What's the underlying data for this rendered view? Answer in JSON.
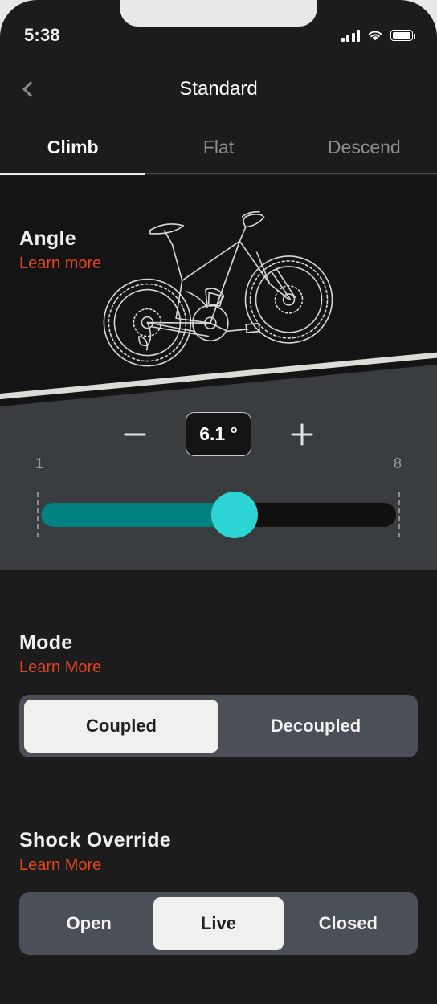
{
  "status_bar": {
    "time": "5:38",
    "signal_icon": "cellular-signal-icon",
    "wifi_icon": "wifi-icon",
    "battery_icon": "battery-icon"
  },
  "nav": {
    "back_icon": "chevron-left-icon",
    "title": "Standard"
  },
  "tabs": [
    {
      "label": "Climb",
      "active": true
    },
    {
      "label": "Flat",
      "active": false
    },
    {
      "label": "Descend",
      "active": false
    }
  ],
  "angle": {
    "title": "Angle",
    "learn_more": "Learn more",
    "illustration": "mountain-bike-on-incline-illustration",
    "value": "6.1 °",
    "decrease_label": "−",
    "increase_label": "+",
    "slider": {
      "min_label": "1",
      "max_label": "8",
      "min": 1,
      "max": 8,
      "value": 5.1,
      "fill_percent": 55,
      "fill_color": "#00807F",
      "thumb_color": "#2DD4D4",
      "track_color": "#101010"
    }
  },
  "mode": {
    "title": "Mode",
    "learn_more": "Learn More",
    "options": [
      {
        "label": "Coupled",
        "selected": true
      },
      {
        "label": "Decoupled",
        "selected": false
      }
    ]
  },
  "shock_override": {
    "title": "Shock Override",
    "learn_more": "Learn More",
    "options": [
      {
        "label": "Open",
        "selected": false
      },
      {
        "label": "Live",
        "selected": true
      },
      {
        "label": "Closed",
        "selected": false
      }
    ]
  },
  "colors": {
    "accent_orange": "#E8441A",
    "teal_fill": "#00807F",
    "teal_thumb": "#2DD4D4",
    "panel_gray": "#3A3D40",
    "page_dark": "#1C1C1C",
    "segment_bg": "#4A4F58",
    "segment_selected": "#F0F0EE"
  }
}
